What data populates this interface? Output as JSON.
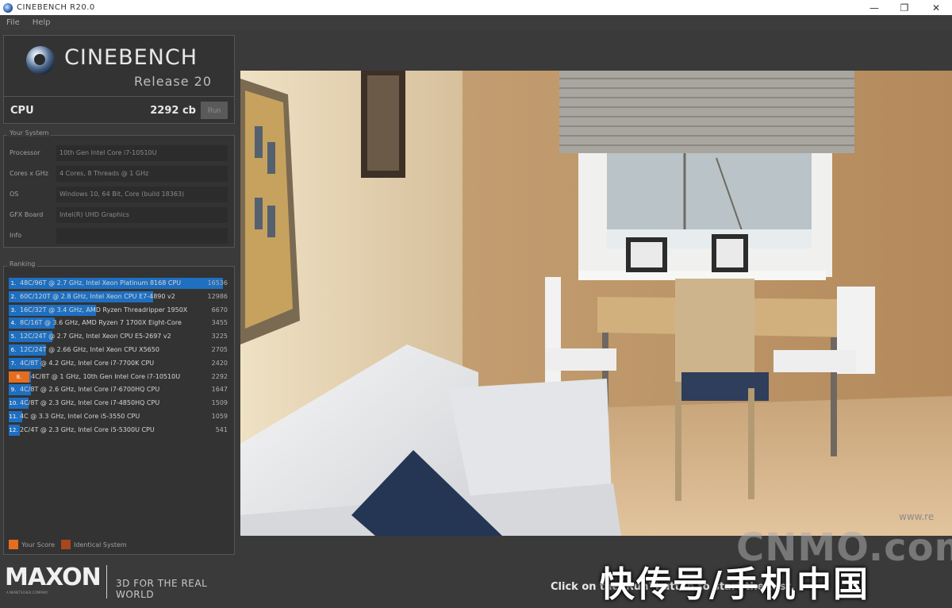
{
  "window": {
    "title": "CINEBENCH R20.0",
    "controls": {
      "minimize": "—",
      "maximize": "❐",
      "close": "✕"
    }
  },
  "menu": {
    "items": [
      "File",
      "Help"
    ]
  },
  "logo": {
    "brand": "CINEBENCH",
    "release": "Release 20"
  },
  "cpu": {
    "label": "CPU",
    "score": "2292 cb",
    "run_label": "Run"
  },
  "system": {
    "title": "Your System",
    "rows": [
      {
        "key": "Processor",
        "value": "10th Gen Intel Core i7-10510U"
      },
      {
        "key": "Cores x GHz",
        "value": "4 Cores, 8 Threads @ 1 GHz"
      },
      {
        "key": "OS",
        "value": "Windows 10, 64 Bit, Core (build 18363)"
      },
      {
        "key": "GFX Board",
        "value": "Intel(R) UHD Graphics"
      },
      {
        "key": "Info",
        "value": ""
      }
    ]
  },
  "ranking": {
    "title": "Ranking",
    "rows": [
      {
        "num": "1.",
        "label": "48C/96T @ 2.7 GHz, Intel Xeon Platinum 8168 CPU",
        "score": "16536",
        "fill": 0.98,
        "mine": false
      },
      {
        "num": "2.",
        "label": "60C/120T @ 2.8 GHz, Intel Xeon CPU E7-4890 v2",
        "score": "12986",
        "fill": 0.66,
        "mine": false
      },
      {
        "num": "3.",
        "label": "16C/32T @ 3.4 GHz, AMD Ryzen Threadripper 1950X",
        "score": "6670",
        "fill": 0.4,
        "mine": false
      },
      {
        "num": "4.",
        "label": "8C/16T @ 3.6 GHz, AMD Ryzen 7 1700X Eight-Core",
        "score": "3455",
        "fill": 0.21,
        "mine": false
      },
      {
        "num": "5.",
        "label": "12C/24T @ 2.7 GHz, Intel Xeon CPU E5-2697 v2",
        "score": "3225",
        "fill": 0.2,
        "mine": false
      },
      {
        "num": "6.",
        "label": "12C/24T @ 2.66 GHz, Intel Xeon CPU X5650",
        "score": "2705",
        "fill": 0.17,
        "mine": false
      },
      {
        "num": "7.",
        "label": "4C/8T @ 4.2 GHz, Intel Core i7-7700K CPU",
        "score": "2420",
        "fill": 0.15,
        "mine": false
      },
      {
        "num": "8.",
        "label": "4C/8T @ 1 GHz, 10th Gen Intel Core i7-10510U",
        "score": "2292",
        "fill": 0.14,
        "mine": true
      },
      {
        "num": "9.",
        "label": "4C/8T @ 2.6 GHz, Intel Core i7-6700HQ CPU",
        "score": "1647",
        "fill": 0.1,
        "mine": false
      },
      {
        "num": "10.",
        "label": "4C/8T @ 2.3 GHz, Intel Core i7-4850HQ CPU",
        "score": "1509",
        "fill": 0.09,
        "mine": false
      },
      {
        "num": "11.",
        "label": "4C @ 3.3 GHz, Intel Core i5-3550 CPU",
        "score": "1059",
        "fill": 0.06,
        "mine": false
      },
      {
        "num": "12.",
        "label": "2C/4T @ 2.3 GHz, Intel Core i5-5300U CPU",
        "score": "541",
        "fill": 0.03,
        "mine": false
      }
    ],
    "legend": {
      "your_score": "Your Score",
      "identical": "Identical System"
    }
  },
  "footer": {
    "maxon": "MAXON",
    "maxon_sub": "A NEMETSCHEK COMPANY",
    "tagline": "3D FOR THE REAL WORLD"
  },
  "render": {
    "instruction": "Click on the 'Run' button to start the test.",
    "watermark_small": "www.re"
  },
  "watermarks": {
    "cnmo": "CNMO.com",
    "source": "快传号/手机中国"
  },
  "colors": {
    "accent_blue": "#1f6fc0",
    "accent_orange": "#e56d1f",
    "identical": "#a8471c"
  }
}
